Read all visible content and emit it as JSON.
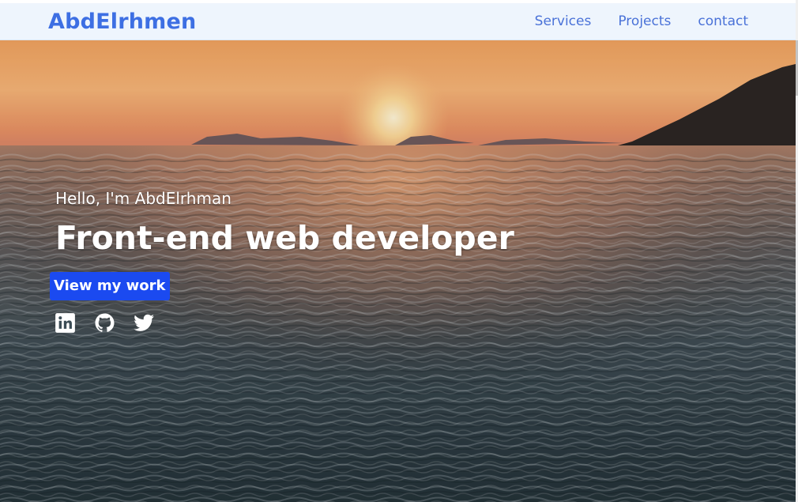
{
  "navbar": {
    "brand": "AbdElrhmen",
    "links": [
      {
        "label": "Services"
      },
      {
        "label": "Projects"
      },
      {
        "label": "contact"
      }
    ]
  },
  "hero": {
    "greeting": "Hello, I'm AbdElrhman",
    "headline": "Front-end web developer",
    "cta_label": "View my work",
    "background": "sunset over ocean waves",
    "socials": [
      {
        "icon": "linkedin-icon"
      },
      {
        "icon": "github-icon"
      },
      {
        "icon": "twitter-icon"
      }
    ]
  },
  "colors": {
    "brand": "#3d6fe3",
    "nav_background": "#eef5fd",
    "nav_link": "#4a72d8",
    "cta_background": "#1b4af0",
    "hero_text": "#ffffff"
  }
}
